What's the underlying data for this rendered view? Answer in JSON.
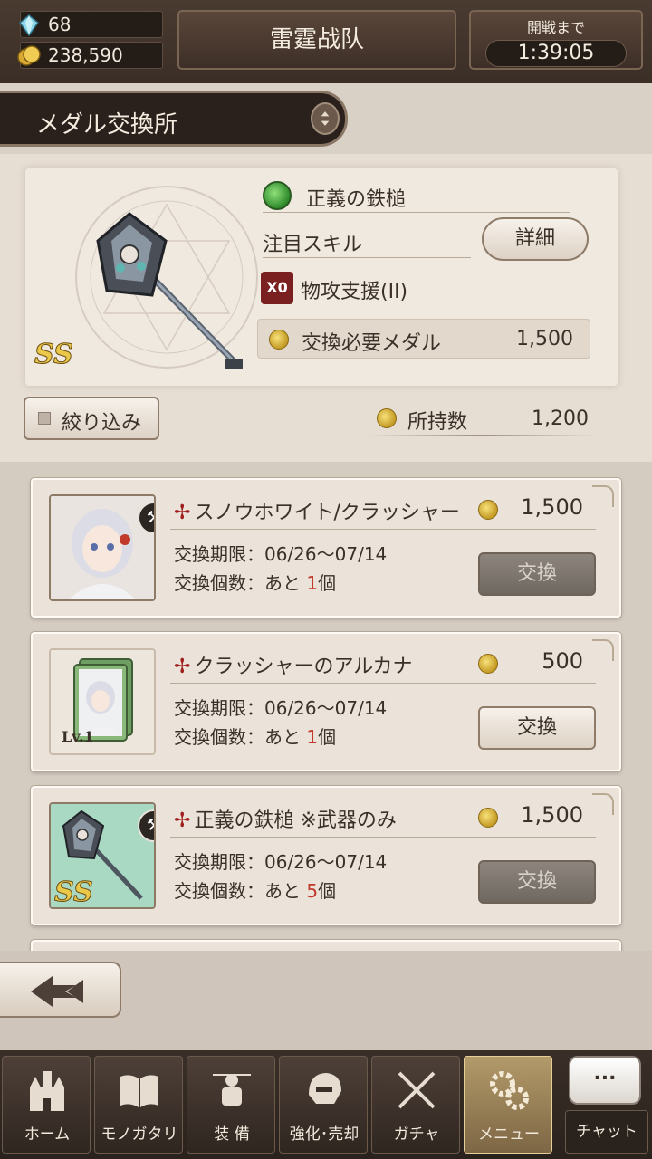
{
  "resources": {
    "gems": "68",
    "coins": "238,590"
  },
  "header": {
    "team_name": "雷霆战队",
    "battle_label": "開戦まで",
    "battle_timer": "1:39:05"
  },
  "section": {
    "title": "メダル交換所"
  },
  "feature": {
    "rank": "SS",
    "weapon_name": "正義の鉄槌",
    "skill_label": "注目スキル",
    "detail_button": "詳細",
    "skill_icon_text": "X0",
    "skill_name": "物攻支援(II)",
    "medal_required_label": "交換必要メダル",
    "medal_required_value": "1,500",
    "filter_button": "絞り込み",
    "owned_label": "所持数",
    "owned_value": "1,200"
  },
  "items": [
    {
      "title": "スノウホワイト/クラッシャー",
      "cost": "1,500",
      "period": "交換期限：06/26〜07/14",
      "count_prefix": "交換個数：あと ",
      "count_num": "1",
      "count_suffix": "個",
      "button": "交換",
      "thumb_rank": ""
    },
    {
      "title": "クラッシャーのアルカナ",
      "cost": "500",
      "period": "交換期限：06/26〜07/14",
      "count_prefix": "交換個数：あと ",
      "count_num": "1",
      "count_suffix": "個",
      "button": "交換",
      "thumb_rank": "Lv.1"
    },
    {
      "title": "正義の鉄槌 ※武器のみ",
      "cost": "1,500",
      "period": "交換期限：06/26〜07/14",
      "count_prefix": "交換個数：あと ",
      "count_num": "5",
      "count_suffix": "個",
      "button": "交換",
      "thumb_rank": "SS"
    }
  ],
  "nav": {
    "items": [
      {
        "label": "ホーム",
        "icon": "castle-icon"
      },
      {
        "label": "モノガタリ",
        "icon": "book-icon"
      },
      {
        "label": "装 備",
        "icon": "armor-icon"
      },
      {
        "label": "強化･売却",
        "icon": "helmet-icon"
      },
      {
        "label": "ガチャ",
        "icon": "crossed-swords-icon"
      },
      {
        "label": "メニュー",
        "icon": "gears-icon"
      }
    ],
    "chat_bubble": "...",
    "chat_label": "チャット"
  },
  "colors": {
    "accent_red": "#c0392b",
    "gold": "#e9c84a"
  }
}
